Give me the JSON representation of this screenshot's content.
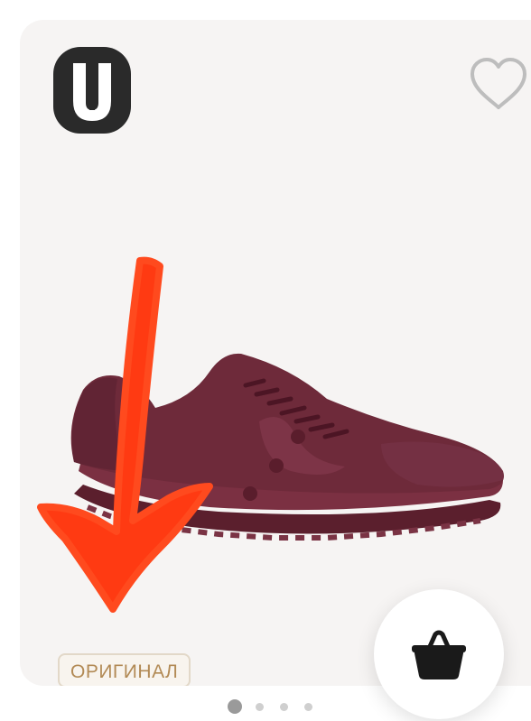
{
  "product_card": {
    "badge_text": "ОРИГИНАЛ",
    "logo_icon": "brand-u-logo-icon",
    "favorite_icon": "heart-outline-icon",
    "cart_icon": "shopping-basket-icon",
    "product_image": "burgundy-sneaker",
    "annotation": "red-arrow-pointing-down",
    "carousel": {
      "total": 4,
      "active": 1
    }
  },
  "colors": {
    "card_bg": "#f6f4f3",
    "shoe": "#6e2a3a",
    "arrow": "#ff3a12",
    "badge_text": "#b28a55"
  }
}
